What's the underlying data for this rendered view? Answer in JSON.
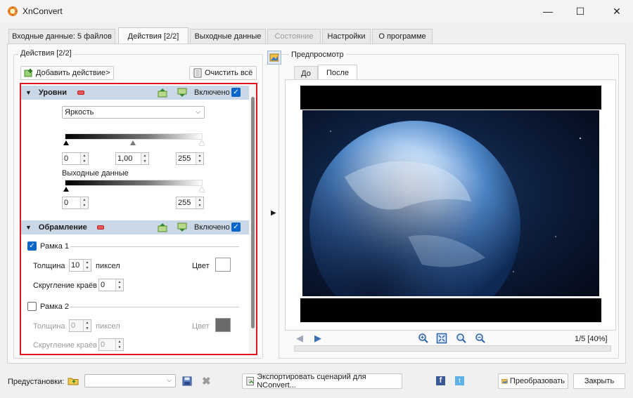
{
  "window": {
    "title": "XnConvert",
    "minimize_glyph": "—",
    "maximize_glyph": "☐",
    "close_glyph": "✕"
  },
  "tabs": [
    {
      "label": "Входные данные: 5 файлов",
      "state": "normal"
    },
    {
      "label": "Действия [2/2]",
      "state": "active"
    },
    {
      "label": "Выходные данные",
      "state": "normal"
    },
    {
      "label": "Состояние",
      "state": "disabled"
    },
    {
      "label": "Настройки",
      "state": "normal"
    },
    {
      "label": "О программе",
      "state": "normal"
    }
  ],
  "actions_panel": {
    "group_label": "Действия [2/2]",
    "add_button": "Добавить действие>",
    "clear_button": "Очистить всё",
    "levels": {
      "title": "Уровни",
      "enabled_label": "Включено",
      "enabled": true,
      "channel": "Яркость",
      "input_min": "0",
      "input_gamma": "1,00",
      "input_max": "255",
      "output_label": "Выходные данные",
      "output_min": "0",
      "output_max": "255"
    },
    "frame": {
      "title": "Обрамление",
      "enabled_label": "Включено",
      "enabled": true,
      "border1": {
        "label": "Рамка 1",
        "checked": true,
        "thickness_label": "Толщина",
        "thickness": "10",
        "unit": "пиксел",
        "color_label": "Цвет",
        "color": "#ffffff",
        "rounding_label": "Скругление краёв",
        "rounding": "0"
      },
      "border2": {
        "label": "Рамка 2",
        "checked": false,
        "thickness_label": "Толщина",
        "thickness": "0",
        "unit": "пиксел",
        "color_label": "Цвет",
        "color": "#6b6b6b",
        "rounding_label": "Скругление краёв",
        "rounding": "0"
      }
    }
  },
  "preview": {
    "group_label": "Предпросмотр",
    "tab_before": "До",
    "tab_after": "После",
    "page_info": "1/5 [40%]"
  },
  "footer": {
    "presets_label": "Предустановки:",
    "preset_value": "",
    "export_button": "Экспортировать сценарий для NConvert...",
    "convert_button": "Преобразовать",
    "close_button": "Закрыть"
  },
  "colors": {
    "accent": "#0a66c9",
    "highlight_border": "#e0161d",
    "section_header": "#c9d7e7"
  }
}
